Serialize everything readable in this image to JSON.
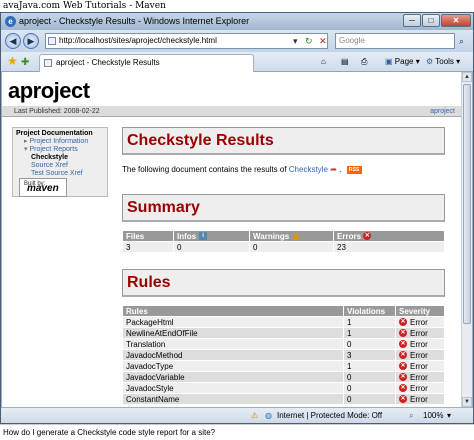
{
  "banner": "avaJava.com Web Tutorials",
  "window": {
    "title": "aproject - Checkstyle Results - Windows Internet Explorer",
    "minimize": "─",
    "maximize": "□",
    "close": "✕"
  },
  "addressbar": {
    "back": "◀",
    "forward": "▶",
    "url": "http://localhost/sites/aproject/checkstyle.html",
    "search_placeholder": "Google"
  },
  "tabbar": {
    "tab_label": "aproject - Checkstyle Results",
    "page_menu": "Page",
    "tools_menu": "Tools"
  },
  "page": {
    "site_title": "aproject",
    "last_published": "Last Published: 2008-02-22",
    "top_link": "aproject",
    "sidebar": {
      "heading": "Project Documentation",
      "items": [
        "Project Information",
        "Project Reports",
        "Checkstyle",
        "Source Xref",
        "Test Source Xref"
      ],
      "badge_small": "Built by:",
      "badge_big": "maven"
    },
    "main_title": "Checkstyle Results",
    "intro_prefix": "The following document contains the results of",
    "intro_link": "Checkstyle",
    "rss_label": "RSS",
    "summary_title": "Summary",
    "summary": {
      "headers": [
        "Files",
        "Infos",
        "Warnings",
        "Errors"
      ],
      "row": [
        "3",
        "0",
        "0",
        "23"
      ]
    },
    "rules_title": "Rules",
    "rules": {
      "headers": [
        "Rules",
        "Violations",
        "Severity"
      ],
      "rows": [
        {
          "rule": "PackageHtml",
          "violations": "1",
          "severity": "Error"
        },
        {
          "rule": "NewlineAtEndOfFile",
          "violations": "1",
          "severity": "Error"
        },
        {
          "rule": "Translation",
          "violations": "0",
          "severity": "Error"
        },
        {
          "rule": "JavadocMethod",
          "violations": "3",
          "severity": "Error"
        },
        {
          "rule": "JavadocType",
          "violations": "1",
          "severity": "Error"
        },
        {
          "rule": "JavadocVariable",
          "violations": "0",
          "severity": "Error"
        },
        {
          "rule": "JavadocStyle",
          "violations": "0",
          "severity": "Error"
        },
        {
          "rule": "ConstantName",
          "violations": "0",
          "severity": "Error"
        }
      ]
    }
  },
  "statusbar": {
    "zone": "Internet | Protected Mode: Off",
    "zoom": "100%"
  },
  "caption": "How do I generate a Checkstyle code style report for a site?",
  "colors": {
    "heading_red": "#990000",
    "link_blue": "#3366aa",
    "table_header": "#999999"
  }
}
